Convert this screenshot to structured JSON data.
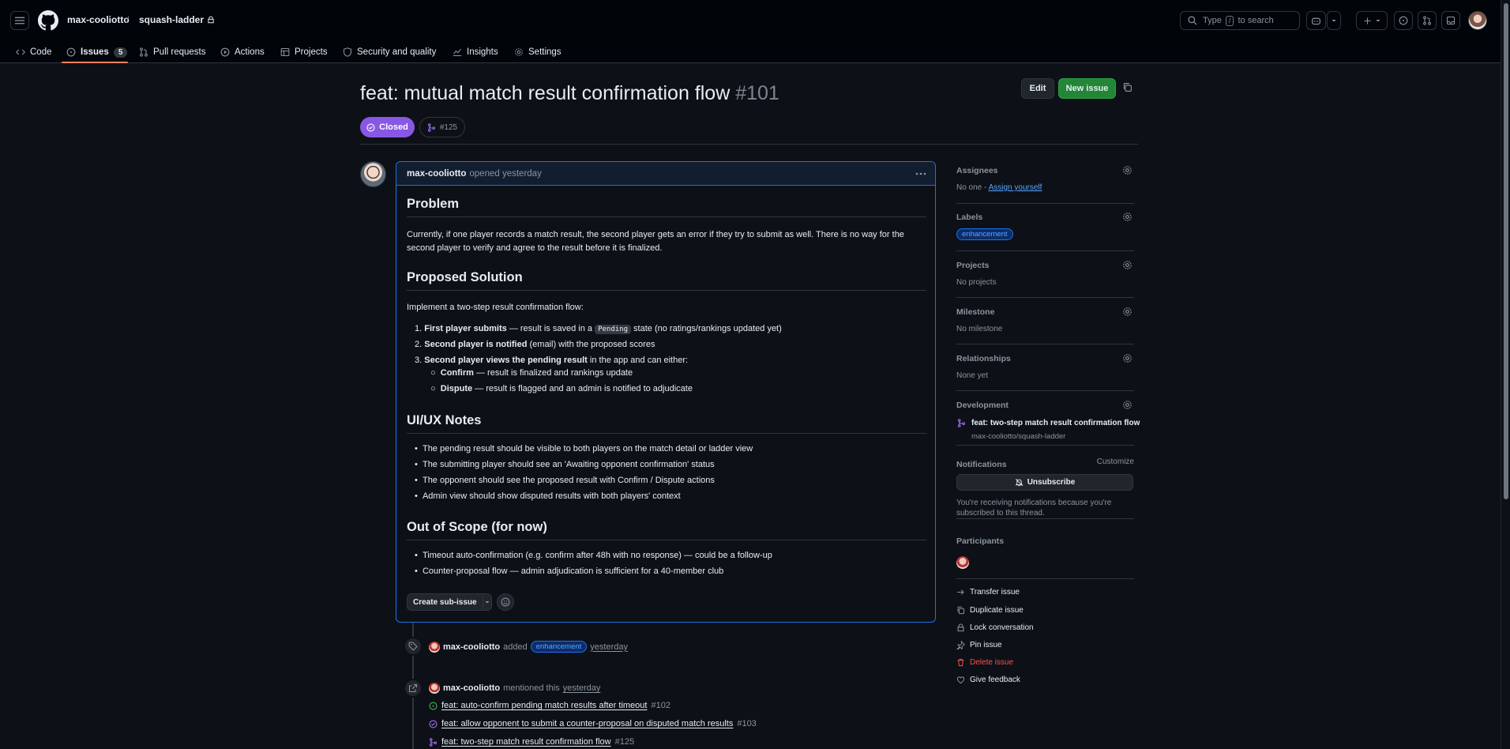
{
  "header": {
    "owner": "max-cooliotto",
    "sep": "/",
    "repo": "squash-ladder",
    "search_type": "Type",
    "search_key": "/",
    "search_suffix": "to search"
  },
  "repo_nav": [
    {
      "label": "Code"
    },
    {
      "label": "Issues",
      "count": "5"
    },
    {
      "label": "Pull requests"
    },
    {
      "label": "Actions"
    },
    {
      "label": "Projects"
    },
    {
      "label": "Security and quality"
    },
    {
      "label": "Insights"
    },
    {
      "label": "Settings"
    }
  ],
  "issue": {
    "title": "feat: mutual match result confirmation flow",
    "number": "#101",
    "edit_label": "Edit",
    "new_label": "New issue",
    "state": "Closed",
    "linked_pr": "#125"
  },
  "comment": {
    "author": "max-cooliotto",
    "meta": "opened yesterday",
    "h_problem": "Problem",
    "problem_text": "Currently, if one player records a match result, the second player gets an error if they try to submit as well. There is no way for the second player to verify and agree to the result before it is finalized.",
    "h_solution": "Proposed Solution",
    "solution_intro": "Implement a two-step result confirmation flow:",
    "steps": [
      {
        "bold": "First player submits",
        "pre": " — result is saved in a ",
        "code": "Pending",
        "post": " state (no ratings/rankings updated yet)"
      },
      {
        "bold": "Second player is notified",
        "post": " (email) with the proposed scores"
      },
      {
        "bold": "Second player views the pending result",
        "post": " in the app and can either:"
      }
    ],
    "sub_steps": [
      {
        "bold": "Confirm",
        "post": " — result is finalized and rankings update"
      },
      {
        "bold": "Dispute",
        "post": " — result is flagged and an admin is notified to adjudicate"
      }
    ],
    "h_ux": "UI/UX Notes",
    "ux_notes": [
      "The pending result should be visible to both players on the match detail or ladder view",
      "The submitting player should see an 'Awaiting opponent confirmation' status",
      "The opponent should see the proposed result with Confirm / Dispute actions",
      "Admin view should show disputed results with both players' context"
    ],
    "h_scope": "Out of Scope (for now)",
    "scope": [
      "Timeout auto-confirmation (e.g. confirm after 48h with no response) — could be a follow-up",
      "Counter-proposal flow — admin adjudication is sufficient for a 40-member club"
    ],
    "sub_issue_label": "Create sub-issue"
  },
  "timeline": {
    "label_event": {
      "user": "max-cooliotto",
      "verb": "added",
      "label": "enhancement",
      "time": "yesterday"
    },
    "mention_event": {
      "user": "max-cooliotto",
      "verb": "mentioned this",
      "time": "yesterday"
    },
    "refs": [
      {
        "title": "feat: auto-confirm pending match results after timeout",
        "num": "#102",
        "kind": "open-issue"
      },
      {
        "title": "feat: allow opponent to submit a counter-proposal on disputed match results",
        "num": "#103",
        "kind": "closed-issue"
      },
      {
        "title": "feat: two-step match result confirmation flow",
        "num": "#125",
        "kind": "pr"
      }
    ]
  },
  "sidebar": {
    "assignees_title": "Assignees",
    "assignees_val": "No one -",
    "assign_yourself": "Assign yourself",
    "labels_title": "Labels",
    "label": "enhancement",
    "projects_title": "Projects",
    "projects_val": "No projects",
    "milestone_title": "Milestone",
    "milestone_val": "No milestone",
    "relationships_title": "Relationships",
    "relationships_val": "None yet",
    "development_title": "Development",
    "dev_pr_title": "feat: two-step match result confirmation flow",
    "dev_pr_repo": "max-cooliotto/squash-ladder",
    "notifications_title": "Notifications",
    "customize": "Customize",
    "unsubscribe": "Unsubscribe",
    "notif_reason": "You're receiving notifications because you're subscribed to this thread.",
    "participants_title": "Participants",
    "actions": [
      "Transfer issue",
      "Duplicate issue",
      "Lock conversation",
      "Pin issue",
      "Delete issue",
      "Give feedback"
    ]
  },
  "colors": {
    "closed": "#8957e5",
    "new_issue": "#238636",
    "accent_link": "#58a6ff",
    "danger": "#f85149",
    "nav_underline": "#f78166"
  }
}
